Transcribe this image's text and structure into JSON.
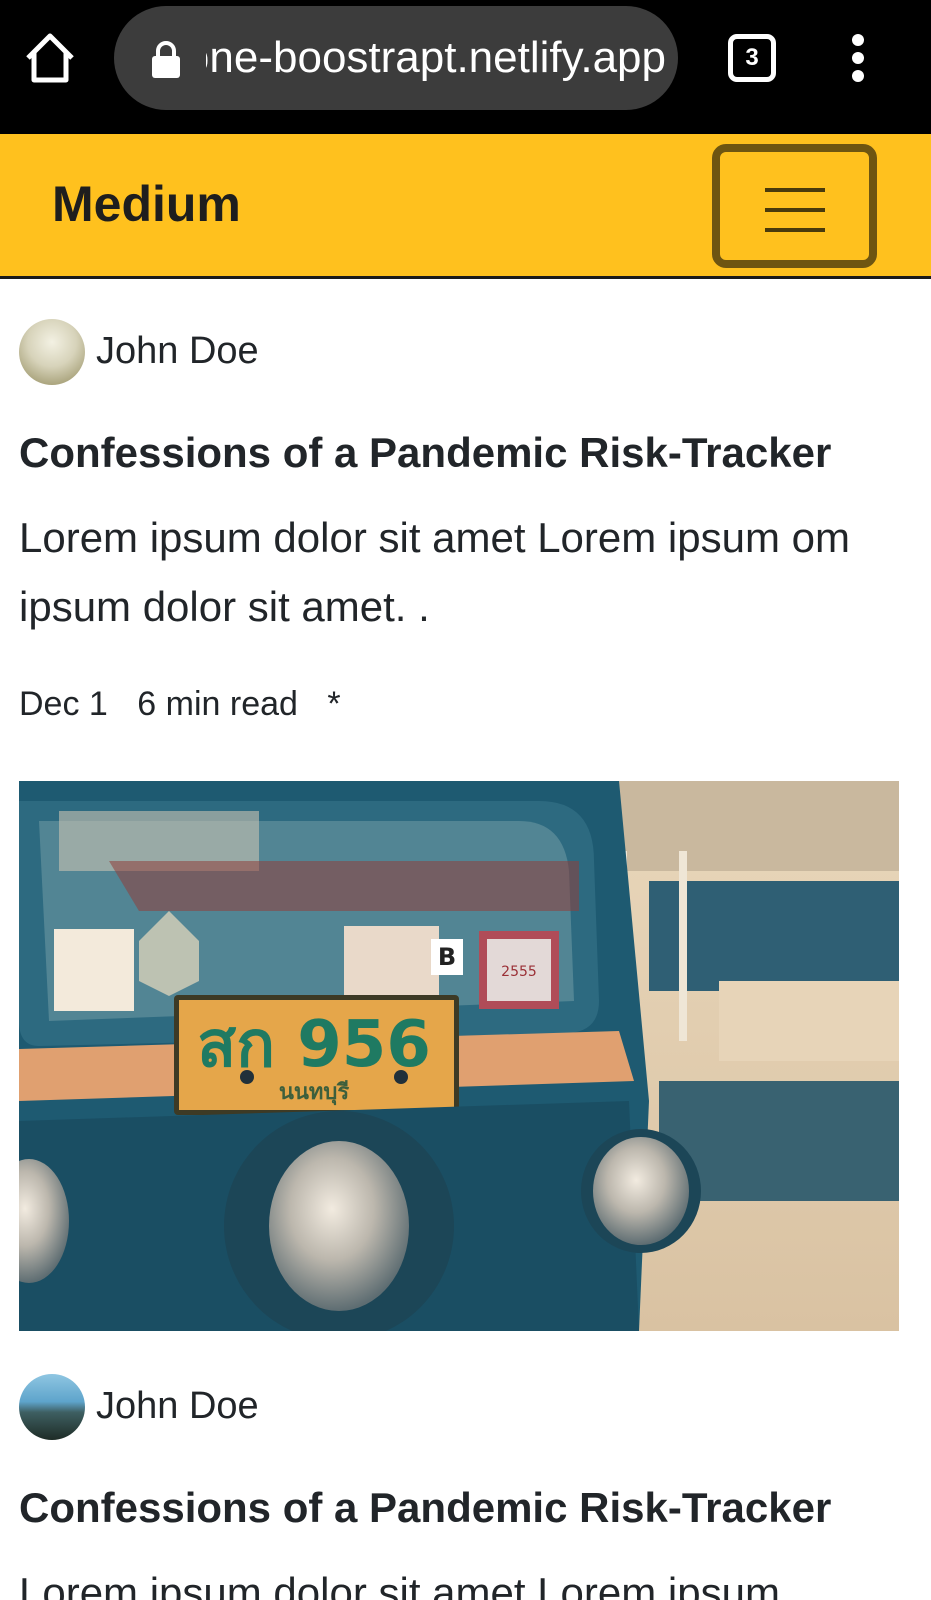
{
  "browser": {
    "url": "medium-clone-boostrapt.netlify.app",
    "tab_count": "3"
  },
  "navbar": {
    "brand": "Medium"
  },
  "posts": [
    {
      "author": "John Doe",
      "title": "Confessions of a Pandemic Risk-Tracker",
      "excerpt": "Lorem ipsum dolor sit amet Lorem ipsum om ipsum dolor sit amet. .",
      "date": "Dec 1",
      "read_time": "6 min read",
      "bookmark": "*",
      "image_plate_text": "สก 956",
      "image_plate_sub": "นนทบุรี",
      "image_sticker_text": "2555"
    },
    {
      "author": "John Doe",
      "title": "Confessions of a Pandemic Risk-Tracker",
      "excerpt": "Lorem ipsum dolor sit amet Lorem ipsum"
    }
  ]
}
